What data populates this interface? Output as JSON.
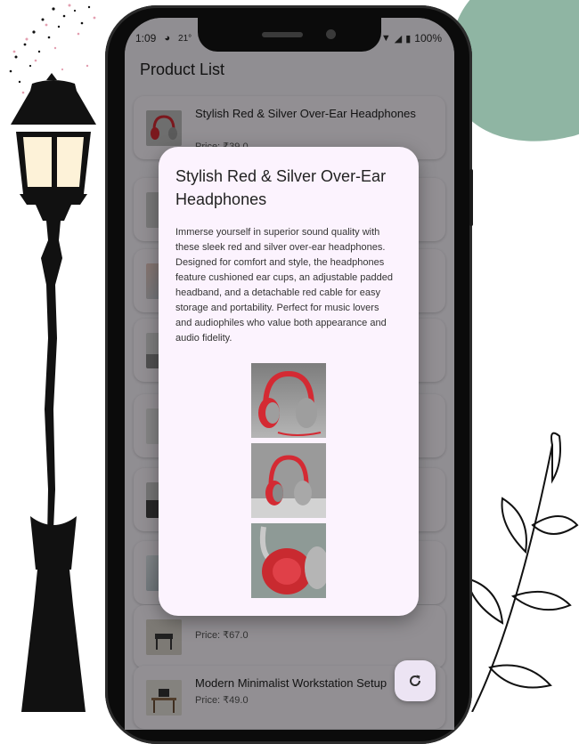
{
  "status_bar": {
    "time": "1:09",
    "weather_temp": "21°",
    "battery": "100%",
    "icons": [
      "alarm-icon",
      "wifi-icon",
      "signal-icon",
      "battery-icon"
    ]
  },
  "app": {
    "title": "Product List"
  },
  "products": [
    {
      "title": "Stylish Red & Silver Over-Ear Headphones",
      "price": "Price: ₹39.0",
      "thumb": "headphones-image"
    },
    {
      "title": "",
      "price": "",
      "thumb": "product-image"
    },
    {
      "title": "",
      "price": "",
      "thumb": "product-image"
    },
    {
      "title": "",
      "price": "",
      "thumb": "product-image"
    },
    {
      "title": "",
      "price": "",
      "thumb": "product-image"
    },
    {
      "title": "",
      "price": "",
      "thumb": "product-image"
    },
    {
      "title": "",
      "price": "",
      "thumb": "product-image"
    },
    {
      "title": "",
      "price": "Price: ₹67.0",
      "thumb": "chair-image"
    },
    {
      "title": "Modern Minimalist Workstation Setup",
      "price": "Price: ₹49.0",
      "thumb": "desk-image"
    }
  ],
  "dialog": {
    "title": "Stylish Red & Silver Over-Ear Headphones",
    "description": "Immerse yourself in superior sound quality with these sleek red and silver over-ear headphones. Designed for comfort and style, the headphones feature cushioned ear cups, an adjustable padded headband, and a detachable red cable for easy storage and portability. Perfect for music lovers and audiophiles who value both appearance and audio fidelity.",
    "images": [
      "headphones-image-1",
      "headphones-image-2",
      "headphones-image-3"
    ]
  },
  "fab": {
    "icon": "refresh-icon"
  },
  "colors": {
    "accent_green": "#8fb5a3",
    "dialog_bg": "#fcf3fe",
    "headphone_red": "#d42a33"
  }
}
